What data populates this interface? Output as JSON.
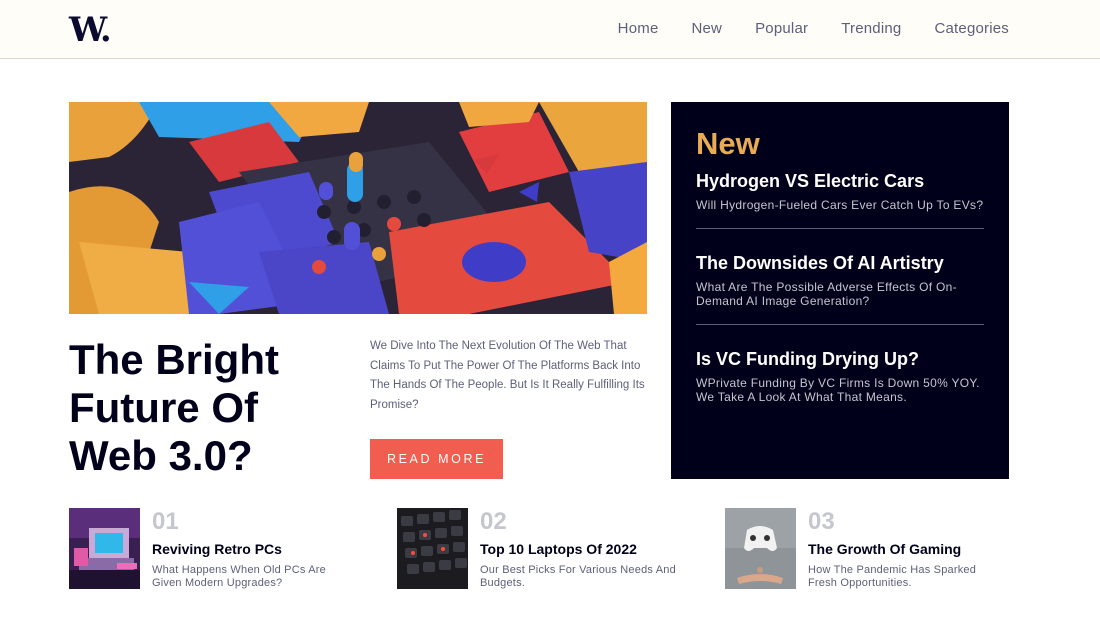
{
  "header": {
    "logo": "W.",
    "nav": [
      "Home",
      "New",
      "Popular",
      "Trending",
      "Categories"
    ]
  },
  "hero": {
    "title": "The Bright Future Of Web 3.0?",
    "description": "We Dive Into The Next Evolution Of The Web That Claims To Put The Power Of The Platforms Back Into The Hands Of The People. But Is It Really Fulfilling Its Promise?",
    "button_label": "READ MORE"
  },
  "new_panel": {
    "heading": "New",
    "items": [
      {
        "title": "Hydrogen VS Electric Cars",
        "description": "Will Hydrogen-Fueled Cars Ever Catch Up To EVs?"
      },
      {
        "title": "The Downsides Of AI Artistry",
        "description": "What Are The Possible Adverse Effects Of On-Demand AI Image Generation?"
      },
      {
        "title": "Is VC Funding Drying Up?",
        "description": "WPrivate Funding By VC Firms Is Down 50% YOY. We Take A Look At What That Means."
      }
    ]
  },
  "cards": [
    {
      "number": "01",
      "title": "Reviving Retro PCs",
      "description": "What Happens When Old PCs Are Given Modern Upgrades?"
    },
    {
      "number": "02",
      "title": "Top 10 Laptops Of 2022",
      "description": "Our Best Picks For Various Needs And Budgets."
    },
    {
      "number": "03",
      "title": "The Growth Of Gaming",
      "description": "How The Pandemic Has Sparked Fresh Opportunities."
    }
  ],
  "colors": {
    "accent_red": "#f15e50",
    "accent_orange": "#e9ab53",
    "dark_navy": "#00001a",
    "grayish_blue": "#5d5f79",
    "off_white": "#fffdfa"
  }
}
